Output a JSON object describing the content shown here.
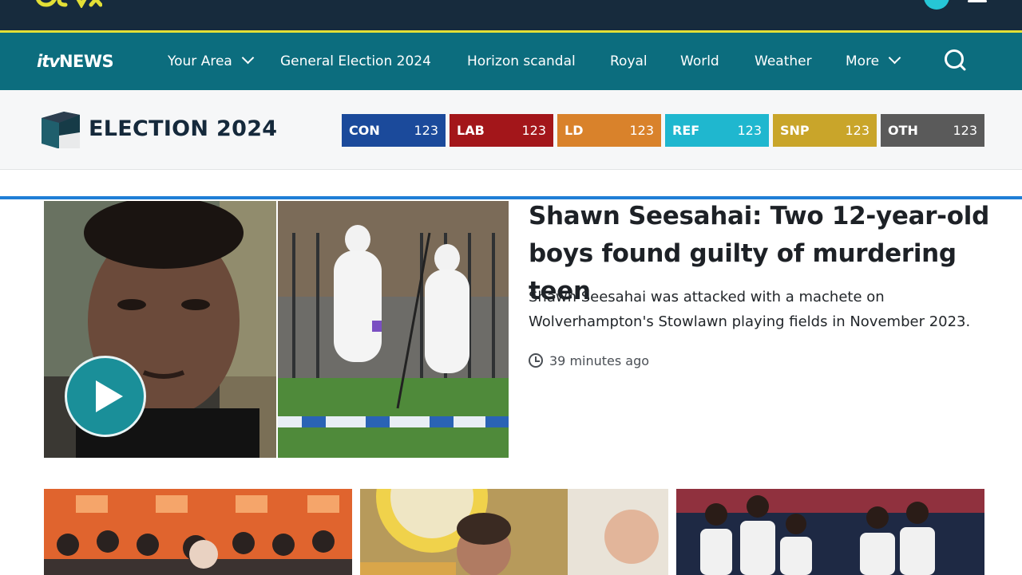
{
  "brand": {
    "itvx": "itvX",
    "news_logo_prefix": "itv",
    "news_logo_suffix": "NEWS"
  },
  "nav": {
    "items": [
      {
        "label": "Your Area",
        "has_dropdown": true
      },
      {
        "label": "General Election 2024"
      },
      {
        "label": "Horizon scandal"
      },
      {
        "label": "Royal"
      },
      {
        "label": "World"
      },
      {
        "label": "Weather"
      },
      {
        "label": "More",
        "has_dropdown": true
      }
    ],
    "search_icon": "search-icon"
  },
  "election": {
    "title": "ELECTION 2024",
    "parties": [
      {
        "name": "CON",
        "value": "123",
        "color": "#1b4a9b"
      },
      {
        "name": "LAB",
        "value": "123",
        "color": "#a3161a"
      },
      {
        "name": "LD",
        "value": "123",
        "color": "#d9822b"
      },
      {
        "name": "REF",
        "value": "123",
        "color": "#1fb7cf"
      },
      {
        "name": "SNP",
        "value": "123",
        "color": "#c9a52a"
      },
      {
        "name": "OTH",
        "value": "123",
        "color": "#5a5a5a"
      }
    ]
  },
  "lead_story": {
    "headline": "Shawn Seesahai: Two 12-year-old boys found guilty of murdering teen",
    "summary": "Shawn Seesahai was attacked with a machete on Wolverhampton's Stowlawn playing fields in November 2023.",
    "timestamp": "39 minutes ago",
    "has_video": true
  },
  "colors": {
    "top_bar": "#172b3d",
    "accent": "#e3df36",
    "nav_bg": "#0c6d7e",
    "link_blue": "#1f7ed6",
    "play": "#1a8f99"
  }
}
